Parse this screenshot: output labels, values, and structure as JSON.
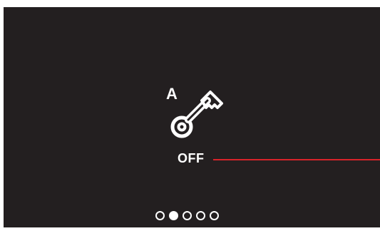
{
  "screen": {
    "background_color": "#231f20",
    "foreground_color": "#ffffff",
    "accent_color": "#d8232a"
  },
  "key": {
    "icon": "key-icon",
    "letter": "A"
  },
  "status": {
    "value": "OFF"
  },
  "pager": {
    "pages": 5,
    "active_index": 1
  }
}
